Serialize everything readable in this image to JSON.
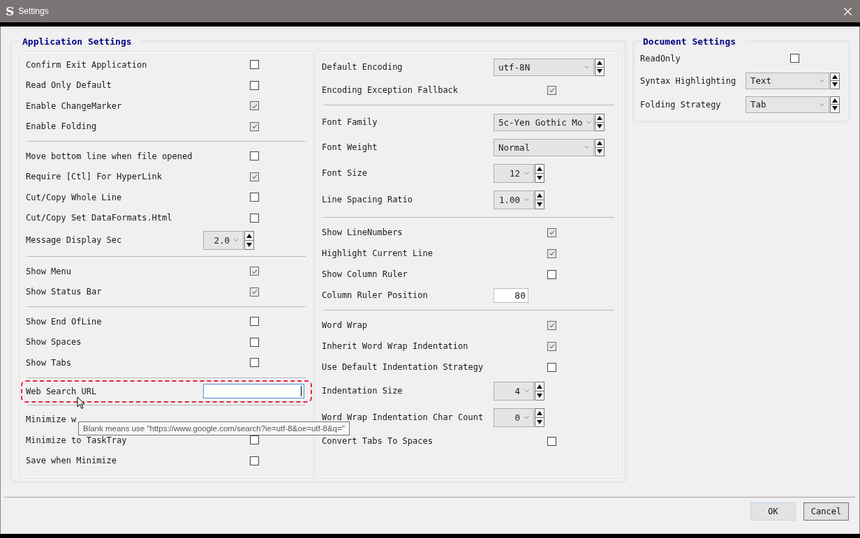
{
  "window": {
    "app_icon": "S",
    "title": "Settings"
  },
  "application_settings": {
    "title": "Application Settings",
    "panels": [
      {
        "groups": [
          {
            "rows": [
              {
                "kind": "checkbox",
                "label": "Confirm Exit Application",
                "checked": false
              },
              {
                "kind": "checkbox",
                "label": "Read Only Default",
                "checked": false
              },
              {
                "kind": "checkbox",
                "label": "Enable ChangeMarker",
                "checked": true
              },
              {
                "kind": "checkbox",
                "label": "Enable Folding",
                "checked": true
              }
            ]
          },
          {
            "rows": [
              {
                "kind": "checkbox",
                "label": "Move bottom line when file opened",
                "checked": false
              },
              {
                "kind": "checkbox",
                "label": "Require [Ctl] For HyperLink",
                "checked": true
              },
              {
                "kind": "checkbox",
                "label": "Cut/Copy Whole Line",
                "checked": false
              },
              {
                "kind": "checkbox",
                "label": "Cut/Copy Set DataFormats.Html",
                "checked": false
              },
              {
                "kind": "number",
                "label": "Message Display Sec",
                "value": "2.0"
              }
            ]
          },
          {
            "rows": [
              {
                "kind": "checkbox",
                "label": "Show Menu",
                "checked": true
              },
              {
                "kind": "checkbox",
                "label": "Show Status Bar",
                "checked": true
              }
            ]
          },
          {
            "rows": [
              {
                "kind": "checkbox",
                "label": "Show End OfLine",
                "checked": false
              },
              {
                "kind": "checkbox",
                "label": "Show Spaces",
                "checked": false
              },
              {
                "kind": "checkbox",
                "label": "Show Tabs",
                "checked": false
              }
            ]
          },
          {
            "rows": [
              {
                "kind": "text",
                "label": "Web Search URL",
                "focused": true,
                "annotated": true
              }
            ]
          },
          {
            "rows": [
              {
                "kind": "label",
                "label": "Minimize w"
              },
              {
                "kind": "checkbox",
                "label": "Minimize to TaskTray",
                "checked": false
              },
              {
                "kind": "checkbox",
                "label": "Save when Minimize",
                "checked": false
              }
            ]
          }
        ]
      },
      {
        "groups": [
          {
            "rows": [
              {
                "kind": "dropdown",
                "label": "Default Encoding",
                "value": "utf-8N"
              },
              {
                "kind": "checkbox",
                "label": "Encoding Exception Fallback",
                "checked": true
              }
            ]
          },
          {
            "rows": [
              {
                "kind": "dropdown",
                "label": "Font Family",
                "value": "5c-Yen Gothic Mo"
              },
              {
                "kind": "dropdown",
                "label": "Font Weight",
                "value": "Normal"
              },
              {
                "kind": "number",
                "label": "Font Size",
                "value": "12"
              },
              {
                "kind": "number",
                "label": "Line Spacing Ratio",
                "value": "1.00"
              }
            ]
          },
          {
            "rows": [
              {
                "kind": "checkbox",
                "label": "Show LineNumbers",
                "checked": true
              },
              {
                "kind": "checkbox",
                "label": "Highlight Current Line",
                "checked": true
              },
              {
                "kind": "checkbox",
                "label": "Show Column Ruler",
                "checked": false
              },
              {
                "kind": "text",
                "label": "Column Ruler Position",
                "value": "80",
                "focused": false,
                "annotated": false
              }
            ]
          },
          {
            "rows": [
              {
                "kind": "checkbox",
                "label": "Word Wrap",
                "checked": true
              },
              {
                "kind": "checkbox",
                "label": "Inherit Word Wrap Indentation",
                "checked": true
              },
              {
                "kind": "checkbox",
                "label": "Use Default Indentation Strategy",
                "checked": false
              },
              {
                "kind": "number",
                "label": "Indentation Size",
                "value": "4"
              },
              {
                "kind": "number",
                "label": "Word Wrap Indentation Char Count",
                "value": "0"
              },
              {
                "kind": "checkbox",
                "label": "Convert Tabs To Spaces",
                "checked": false
              }
            ]
          }
        ]
      }
    ]
  },
  "document_settings": {
    "title": "Document Settings",
    "rows": [
      {
        "kind": "checkbox",
        "label": "ReadOnly",
        "checked": false
      },
      {
        "kind": "dropdown",
        "label": "Syntax Highlighting",
        "value": "Text"
      },
      {
        "kind": "dropdown",
        "label": "Folding Strategy",
        "value": "Tab"
      }
    ]
  },
  "tooltip": {
    "text": "Blank means use \"https://www.google.com/search?ie=utf-8&oe=utf-8&q=\""
  },
  "buttons": [
    {
      "label": "OK",
      "default": true
    },
    {
      "label": "Cancel",
      "default": false
    }
  ]
}
